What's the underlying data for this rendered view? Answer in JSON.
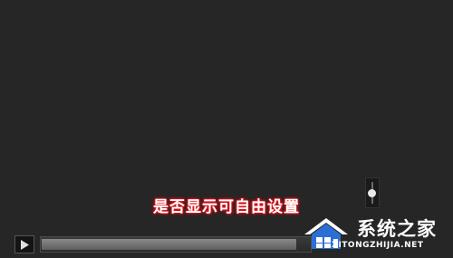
{
  "player": {
    "caption": "是否显示可自由设置",
    "play_icon": "play-icon",
    "progress_fraction": 0.95,
    "volume_fraction": 0.6
  },
  "watermark": {
    "name": "系统之家",
    "url": "XITONGZHIJIA.NET",
    "logo_icon": "house-logo-icon"
  },
  "colors": {
    "background": "#262626",
    "caption_glow": "#e81d2a",
    "watermark_blue": "#2b6fd6"
  }
}
